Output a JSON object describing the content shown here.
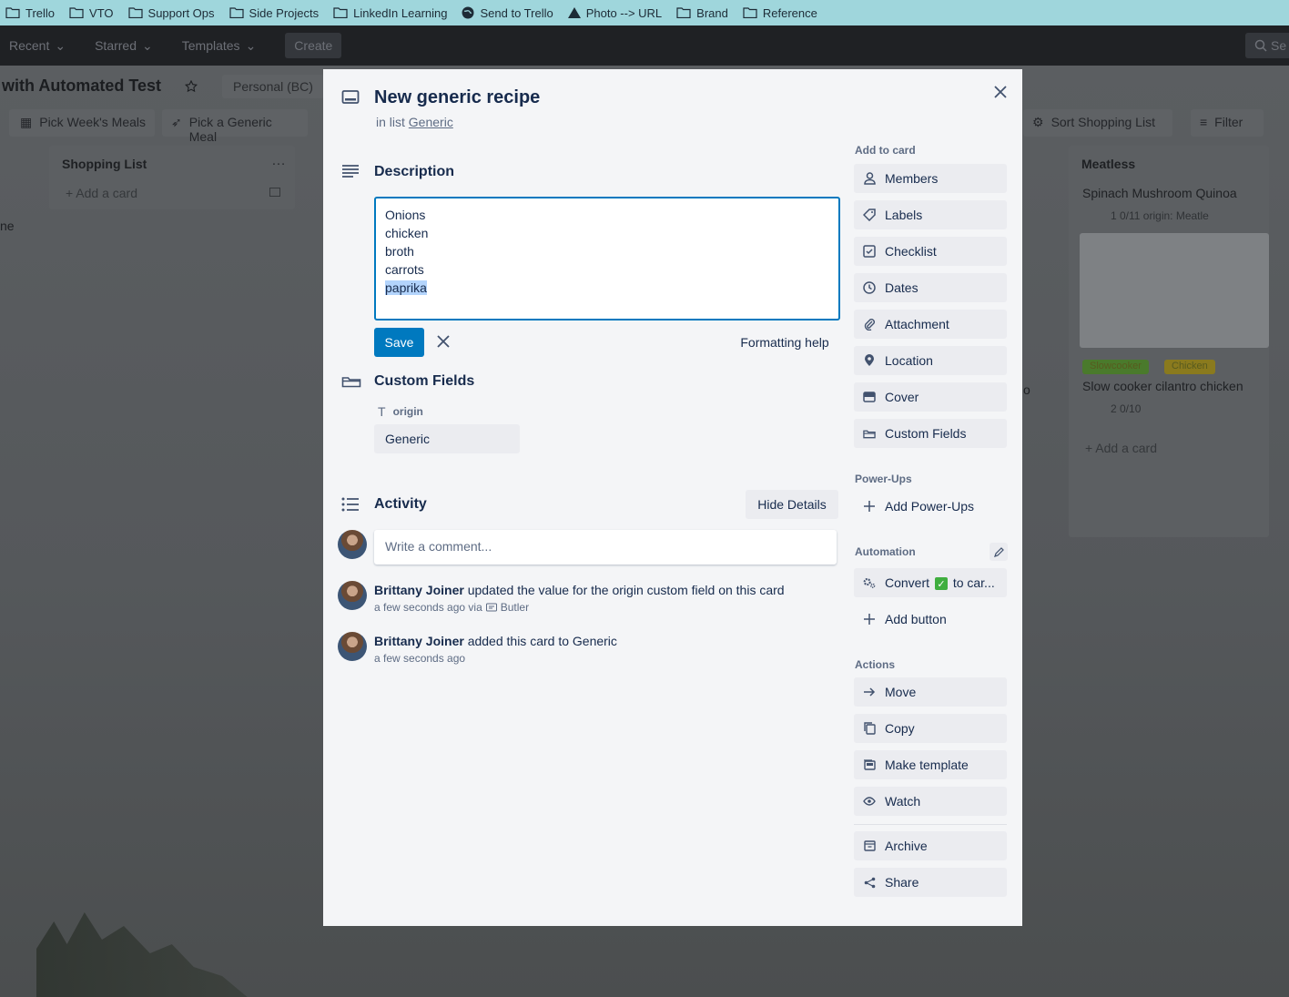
{
  "bookmarks": [
    {
      "label": "Trello",
      "icon": "folder-icon"
    },
    {
      "label": "VTO",
      "icon": "folder-icon"
    },
    {
      "label": "Support Ops",
      "icon": "folder-icon"
    },
    {
      "label": "Side Projects",
      "icon": "folder-icon"
    },
    {
      "label": "LinkedIn Learning",
      "icon": "folder-icon"
    },
    {
      "label": "Send to Trello",
      "icon": "globe-icon"
    },
    {
      "label": "Photo --> URL",
      "icon": "triangle-icon"
    },
    {
      "label": "Brand",
      "icon": "folder-icon"
    },
    {
      "label": "Reference",
      "icon": "folder-icon"
    }
  ],
  "topnav": {
    "recent": "Recent",
    "starred": "Starred",
    "templates": "Templates",
    "create": "Create",
    "search_partial": "Se"
  },
  "board": {
    "title": "with Automated Test",
    "workspace": "Personal (BC)",
    "btn_pick_week": "Pick Week's Meals",
    "btn_pick_generic": "Pick a Generic Meal",
    "btn_sort": "Sort Shopping List",
    "btn_filter": "Filter",
    "shopping_list_title": "Shopping List",
    "shopping_add_card": "+ Add a card",
    "meatless_title": "Meatless",
    "meatless_card1": "Spinach Mushroom Quinoa",
    "meatless_card1_meta": "1   0/11   origin: Meatle",
    "meatless_label1": "Slowcooker",
    "meatless_label2": "Chicken",
    "meatless_card2": "Slow cooker cilantro chicken",
    "meatless_card2_meta": "2   0/10",
    "meatless_add_card": "+ Add a card",
    "left_partial": "ne",
    "partial_letter": "o"
  },
  "modal": {
    "title": "New generic recipe",
    "in_list_prefix": "in list",
    "in_list_name": "Generic",
    "description_title": "Description",
    "description_lines": [
      "Onions",
      "chicken",
      "broth",
      "carrots",
      "paprika"
    ],
    "save_label": "Save",
    "formatting_help": "Formatting help",
    "custom_fields_title": "Custom Fields",
    "custom_field_name": "origin",
    "custom_field_value": "Generic",
    "activity_title": "Activity",
    "hide_details": "Hide Details",
    "comment_placeholder": "Write a comment...",
    "activity": [
      {
        "user": "Brittany Joiner",
        "text": " updated the value for the origin custom field on this card",
        "time": "a few seconds ago via",
        "via": "Butler"
      },
      {
        "user": "Brittany Joiner",
        "text": " added this card to Generic",
        "time": "a few seconds ago",
        "via": ""
      }
    ]
  },
  "sidebar": {
    "add_to_card": "Add to card",
    "add_items": [
      "Members",
      "Labels",
      "Checklist",
      "Dates",
      "Attachment",
      "Location",
      "Cover",
      "Custom Fields"
    ],
    "power_ups": "Power-Ups",
    "add_power_ups": "Add Power-Ups",
    "automation": "Automation",
    "convert_prefix": "Convert",
    "convert_suffix": "to car...",
    "add_button": "Add button",
    "actions": "Actions",
    "action_items": [
      "Move",
      "Copy",
      "Make template",
      "Watch"
    ],
    "archive": "Archive",
    "share": "Share"
  },
  "colors": {
    "accent": "#0079bf",
    "modal_bg": "#f4f5f7",
    "button_bg": "#ebecf0",
    "bookmark_bar": "#9fd6dc"
  }
}
